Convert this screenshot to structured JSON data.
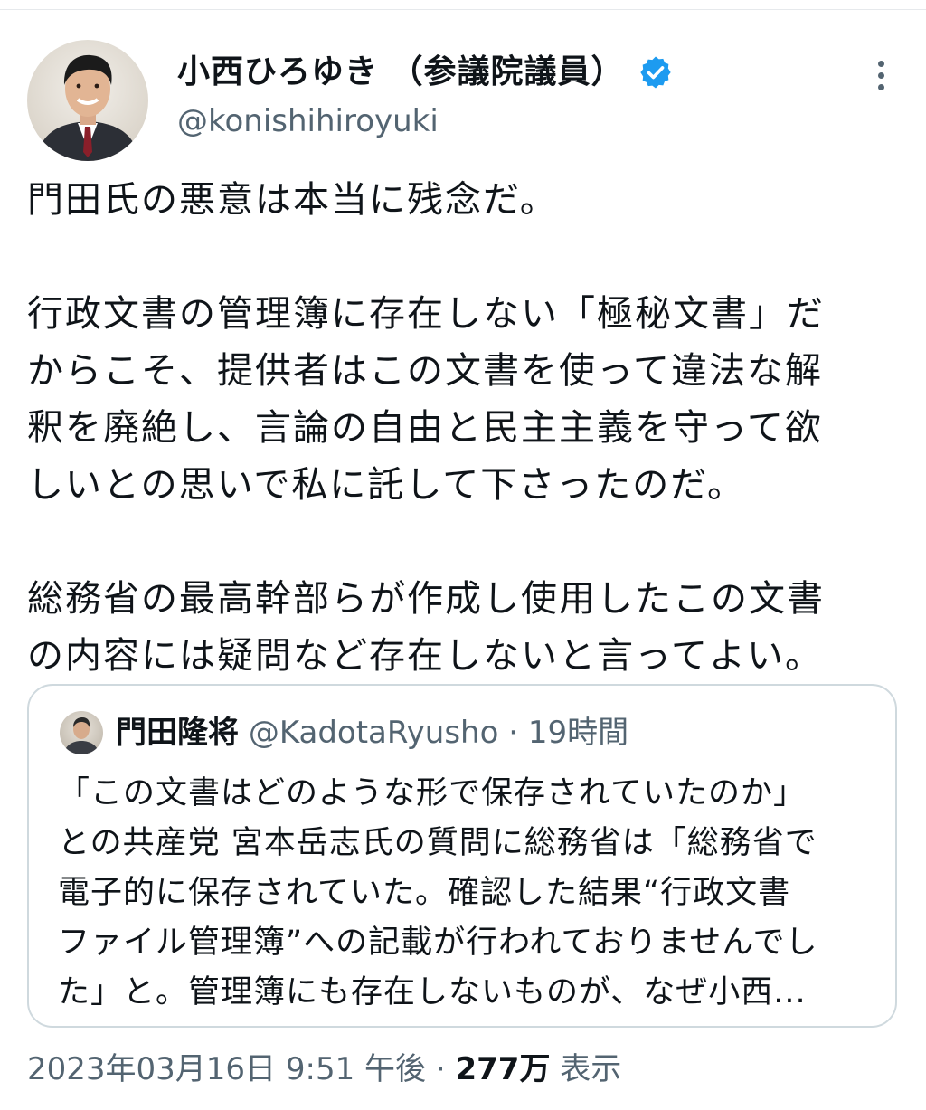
{
  "author": {
    "name": "小西ひろゆき （参議院議員）",
    "handle": "@konishihiroyuki",
    "verified_color": "#1d9bf0"
  },
  "tweet": {
    "paragraphs": [
      "門田氏の悪意は本当に残念だ。",
      "行政文書の管理簿に存在しない「極秘文書」だ\nからこそ、提供者はこの文書を使って違法な解\n釈を廃絶し、言論の自由と民主主義を守って欲\nしいとの思いで私に託して下さったのだ。",
      "総務省の最高幹部らが作成し使用したこの文書\nの内容には疑問など存在しないと言ってよい。"
    ]
  },
  "quote": {
    "name": "門田隆将",
    "handle": "@KadotaRyusho",
    "separator": " · ",
    "time": "19時間",
    "text": "「この文書はどのような形で保存されていたのか」\nとの共産党 宮本岳志氏の質問に総務省は「総務省で\n電子的に保存されていた。確認した結果“行政文書\nファイル管理簿”への記載が行われておりませんでし\nた」と。管理簿にも存在しないものが、なぜ小西..."
  },
  "meta": {
    "timestamp": "2023年03月16日 9:51 午後",
    "separator": " · ",
    "views_count": "277万",
    "views_label": "表示"
  }
}
